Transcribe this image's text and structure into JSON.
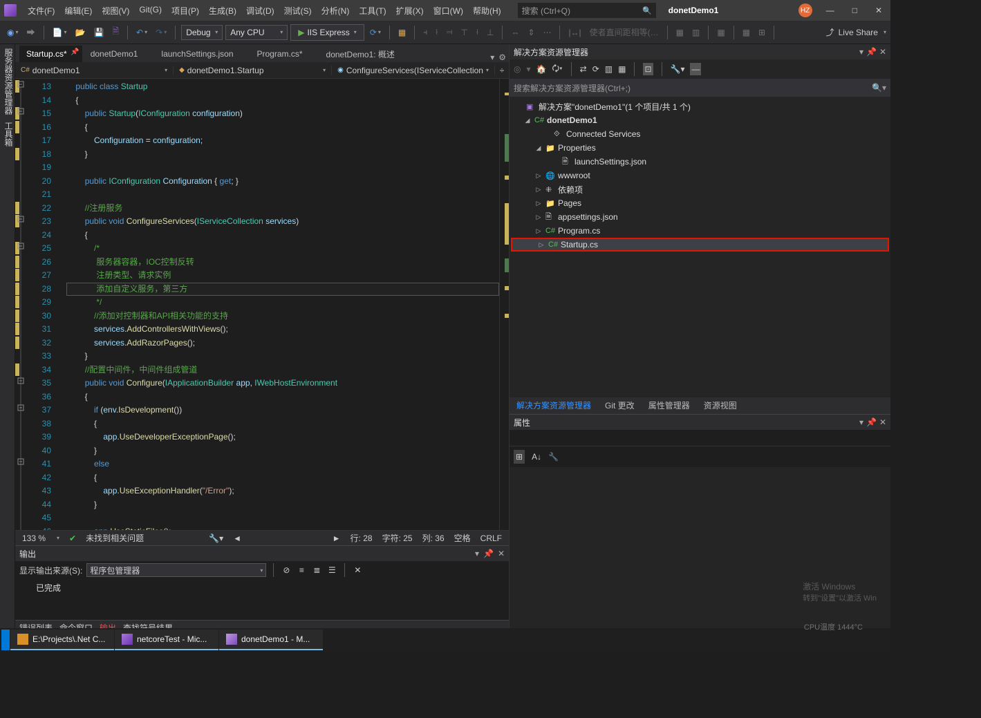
{
  "titlebar": {
    "menus": [
      "文件(F)",
      "编辑(E)",
      "视图(V)",
      "Git(G)",
      "项目(P)",
      "生成(B)",
      "调试(D)",
      "测试(S)",
      "分析(N)",
      "工具(T)",
      "扩展(X)",
      "窗口(W)",
      "帮助(H)"
    ],
    "search_placeholder": "搜索 (Ctrl+Q)",
    "project_name": "donetDemo1",
    "avatar": "HZ"
  },
  "toolbar": {
    "config": "Debug",
    "platform": "Any CPU",
    "run_target": "IIS Express",
    "measure_label": "使者直间距相等(…",
    "liveshare": "Live Share"
  },
  "leftstrip": {
    "a": "服务器资源管理器",
    "b": "工具箱"
  },
  "tabs": {
    "items": [
      {
        "label": "Startup.cs*",
        "active": true
      },
      {
        "label": "donetDemo1"
      },
      {
        "label": "launchSettings.json"
      },
      {
        "label": "Program.cs*"
      },
      {
        "label": "donetDemo1: 概述"
      }
    ]
  },
  "navbar": {
    "a": "donetDemo1",
    "b": "donetDemo1.Startup",
    "c": "ConfigureServices(IServiceCollection"
  },
  "code": {
    "first_line": 13,
    "lines": [
      [
        [
          "kw",
          "public"
        ],
        [
          "op",
          " "
        ],
        [
          "kw",
          "class"
        ],
        [
          "op",
          " "
        ],
        [
          "ty",
          "Startup"
        ]
      ],
      [
        [
          "op",
          "{"
        ]
      ],
      [
        [
          "op",
          "    "
        ],
        [
          "kw",
          "public"
        ],
        [
          "op",
          " "
        ],
        [
          "ty",
          "Startup"
        ],
        [
          "op",
          "("
        ],
        [
          "ty",
          "IConfiguration"
        ],
        [
          "op",
          " "
        ],
        [
          "var",
          "configuration"
        ],
        [
          "op",
          ")"
        ]
      ],
      [
        [
          "op",
          "    {"
        ]
      ],
      [
        [
          "op",
          "        "
        ],
        [
          "var",
          "Configuration"
        ],
        [
          "op",
          " = "
        ],
        [
          "var",
          "configuration"
        ],
        [
          "op",
          ";"
        ]
      ],
      [
        [
          "op",
          "    }"
        ]
      ],
      [
        [
          "op",
          ""
        ]
      ],
      [
        [
          "op",
          "    "
        ],
        [
          "kw",
          "public"
        ],
        [
          "op",
          " "
        ],
        [
          "ty",
          "IConfiguration"
        ],
        [
          "op",
          " "
        ],
        [
          "var",
          "Configuration"
        ],
        [
          "op",
          " { "
        ],
        [
          "kw",
          "get"
        ],
        [
          "op",
          "; }"
        ]
      ],
      [
        [
          "op",
          ""
        ]
      ],
      [
        [
          "op",
          "    "
        ],
        [
          "cm",
          "//注册服务"
        ]
      ],
      [
        [
          "op",
          "    "
        ],
        [
          "kw",
          "public"
        ],
        [
          "op",
          " "
        ],
        [
          "kw",
          "void"
        ],
        [
          "op",
          " "
        ],
        [
          "fn",
          "ConfigureServices"
        ],
        [
          "op",
          "("
        ],
        [
          "ty",
          "IServiceCollection"
        ],
        [
          "op",
          " "
        ],
        [
          "var",
          "services"
        ],
        [
          "op",
          ")"
        ]
      ],
      [
        [
          "op",
          "    {"
        ]
      ],
      [
        [
          "op",
          "        "
        ],
        [
          "cm",
          "/*"
        ]
      ],
      [
        [
          "op",
          "         "
        ],
        [
          "cm",
          "服务器容器，IOC控制反转"
        ]
      ],
      [
        [
          "op",
          "         "
        ],
        [
          "cm",
          "注册类型、请求实例"
        ]
      ],
      [
        [
          "op",
          "         "
        ],
        [
          "cm",
          "添加自定义服务，第三方"
        ]
      ],
      [
        [
          "op",
          "         "
        ],
        [
          "cm",
          "*/"
        ]
      ],
      [
        [
          "op",
          "        "
        ],
        [
          "cm",
          "//添加对控制器和API相关功能的支持"
        ]
      ],
      [
        [
          "op",
          "        "
        ],
        [
          "var",
          "services"
        ],
        [
          "op",
          "."
        ],
        [
          "fn",
          "AddControllersWithViews"
        ],
        [
          "op",
          "();"
        ]
      ],
      [
        [
          "op",
          "        "
        ],
        [
          "var",
          "services"
        ],
        [
          "op",
          "."
        ],
        [
          "fn",
          "AddRazorPages"
        ],
        [
          "op",
          "();"
        ]
      ],
      [
        [
          "op",
          "    }"
        ]
      ],
      [
        [
          "op",
          "    "
        ],
        [
          "cm",
          "//配置中间件，中间件组成管道"
        ]
      ],
      [
        [
          "op",
          "    "
        ],
        [
          "kw",
          "public"
        ],
        [
          "op",
          " "
        ],
        [
          "kw",
          "void"
        ],
        [
          "op",
          " "
        ],
        [
          "fn",
          "Configure"
        ],
        [
          "op",
          "("
        ],
        [
          "ty",
          "IApplicationBuilder"
        ],
        [
          "op",
          " "
        ],
        [
          "var",
          "app"
        ],
        [
          "op",
          ", "
        ],
        [
          "ty",
          "IWebHostEnvironment"
        ]
      ],
      [
        [
          "op",
          "    {"
        ]
      ],
      [
        [
          "op",
          "        "
        ],
        [
          "kw",
          "if"
        ],
        [
          "op",
          " ("
        ],
        [
          "var",
          "env"
        ],
        [
          "op",
          "."
        ],
        [
          "fn",
          "IsDevelopment"
        ],
        [
          "op",
          "())"
        ]
      ],
      [
        [
          "op",
          "        {"
        ]
      ],
      [
        [
          "op",
          "            "
        ],
        [
          "var",
          "app"
        ],
        [
          "op",
          "."
        ],
        [
          "fn",
          "UseDeveloperExceptionPage"
        ],
        [
          "op",
          "();"
        ]
      ],
      [
        [
          "op",
          "        }"
        ]
      ],
      [
        [
          "op",
          "        "
        ],
        [
          "kw",
          "else"
        ]
      ],
      [
        [
          "op",
          "        {"
        ]
      ],
      [
        [
          "op",
          "            "
        ],
        [
          "var",
          "app"
        ],
        [
          "op",
          "."
        ],
        [
          "fn",
          "UseExceptionHandler"
        ],
        [
          "op",
          "("
        ],
        [
          "str",
          "\"/Error\""
        ],
        [
          "op",
          ");"
        ]
      ],
      [
        [
          "op",
          "        }"
        ]
      ],
      [
        [
          "op",
          ""
        ]
      ],
      [
        [
          "op",
          "        "
        ],
        [
          "var",
          "app"
        ],
        [
          "op",
          "."
        ],
        [
          "fn",
          "UseStaticFiles"
        ],
        [
          "op",
          "();"
        ]
      ]
    ]
  },
  "status": {
    "zoom": "133 %",
    "issues": "未找到相关问题",
    "ln": "行: 28",
    "ch": "字符: 25",
    "col": "列: 36",
    "ins": "空格",
    "enc": "CRLF"
  },
  "output": {
    "title": "输出",
    "label": "显示输出来源(S):",
    "source": "程序包管理器",
    "done": "已完成"
  },
  "bottom": {
    "a": "错误列表",
    "b": "命今窗口",
    "c": "输出",
    "d": "查找符号结果"
  },
  "solution": {
    "title": "解决方案资源管理器",
    "search_placeholder": "搜索解决方案资源管理器(Ctrl+;)",
    "root": "解决方案\"donetDemo1\"(1 个项目/共 1 个)",
    "proj": "donetDemo1",
    "items": {
      "connected": "Connected Services",
      "props": "Properties",
      "launch": "launchSettings.json",
      "www": "wwwroot",
      "deps": "依赖项",
      "pages": "Pages",
      "appsettings": "appsettings.json",
      "program": "Program.cs",
      "startup": "Startup.cs"
    },
    "tabs": {
      "a": "解决方案资源管理器",
      "b": "Git 更改",
      "c": "属性管理器",
      "d": "资源视图"
    }
  },
  "props": {
    "title": "属性"
  },
  "watermark": {
    "title": "激活 Windows",
    "sub": "转到\"设置\"以激活 Win"
  },
  "cputag": "CPU温度   1444°C",
  "taskbar": {
    "a": "E:\\Projects\\.Net C...",
    "b": "netcoreTest - Mic...",
    "c": "donetDemo1 - M..."
  }
}
